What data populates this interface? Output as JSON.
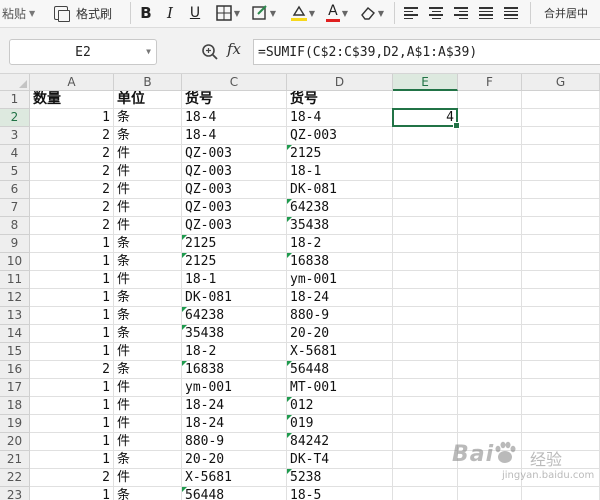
{
  "ribbon": {
    "paste_label": "粘贴",
    "format_painter_label": "格式刷",
    "bold_label": "B",
    "italic_label": "I",
    "underline_label": "U",
    "font_color_label": "A",
    "merge_center_label": "合并居中",
    "icons": [
      "format-painter-icon",
      "bold-icon",
      "italic-icon",
      "underline-icon",
      "border-icon",
      "fill-style-icon",
      "highlight-color-icon",
      "font-color-icon",
      "clear-format-icon",
      "align-left-icon",
      "align-center-icon",
      "align-right-icon",
      "justify-icon",
      "distribute-icon"
    ],
    "colors": {
      "highlight": "#f7d81c",
      "font_color": "#e02020"
    }
  },
  "formula_bar": {
    "name_box": "E2",
    "fx_label": "fx",
    "formula": "=SUMIF(C$2:C$39,D2,A$1:A$39)"
  },
  "grid": {
    "columns": [
      "A",
      "B",
      "C",
      "D",
      "E",
      "F",
      "G"
    ],
    "selected_column": "E",
    "selected_row": 2,
    "selected_cell": "E2",
    "selected_cell_value": "4",
    "accent_color": "#217346",
    "number_flag_color": "#1f9b4e",
    "header_row": {
      "A": "数量",
      "B": "单位",
      "C": "货号",
      "D": "货号"
    },
    "rows": [
      {
        "row": 2,
        "a": "1",
        "b": "条",
        "c": "18-4",
        "d": "18-4"
      },
      {
        "row": 3,
        "a": "2",
        "b": "条",
        "c": "18-4",
        "d": "QZ-003"
      },
      {
        "row": 4,
        "a": "2",
        "b": "件",
        "c": "QZ-003",
        "d": "2125"
      },
      {
        "row": 5,
        "a": "2",
        "b": "件",
        "c": "QZ-003",
        "d": "18-1"
      },
      {
        "row": 6,
        "a": "2",
        "b": "件",
        "c": "QZ-003",
        "d": "DK-081"
      },
      {
        "row": 7,
        "a": "2",
        "b": "件",
        "c": "QZ-003",
        "d": "64238"
      },
      {
        "row": 8,
        "a": "2",
        "b": "件",
        "c": "QZ-003",
        "d": "35438"
      },
      {
        "row": 9,
        "a": "1",
        "b": "条",
        "c": "2125",
        "d": "18-2"
      },
      {
        "row": 10,
        "a": "1",
        "b": "条",
        "c": "2125",
        "d": "16838"
      },
      {
        "row": 11,
        "a": "1",
        "b": "件",
        "c": "18-1",
        "d": "ym-001"
      },
      {
        "row": 12,
        "a": "1",
        "b": "条",
        "c": "DK-081",
        "d": "18-24"
      },
      {
        "row": 13,
        "a": "1",
        "b": "条",
        "c": "64238",
        "d": "880-9"
      },
      {
        "row": 14,
        "a": "1",
        "b": "条",
        "c": "35438",
        "d": "20-20"
      },
      {
        "row": 15,
        "a": "1",
        "b": "件",
        "c": "18-2",
        "d": "X-5681"
      },
      {
        "row": 16,
        "a": "2",
        "b": "条",
        "c": "16838",
        "d": "56448"
      },
      {
        "row": 17,
        "a": "1",
        "b": "件",
        "c": "ym-001",
        "d": "MT-001"
      },
      {
        "row": 18,
        "a": "1",
        "b": "件",
        "c": "18-24",
        "d": "012"
      },
      {
        "row": 19,
        "a": "1",
        "b": "件",
        "c": "18-24",
        "d": "019"
      },
      {
        "row": 20,
        "a": "1",
        "b": "件",
        "c": "880-9",
        "d": "84242"
      },
      {
        "row": 21,
        "a": "1",
        "b": "条",
        "c": "20-20",
        "d": "DK-T4"
      },
      {
        "row": 22,
        "a": "2",
        "b": "件",
        "c": "X-5681",
        "d": "5238"
      },
      {
        "row": 23,
        "a": "1",
        "b": "条",
        "c": "56448",
        "d": "18-5"
      }
    ],
    "flagged_cells": [
      "C9",
      "C10",
      "C13",
      "C14",
      "C16",
      "C23",
      "D4",
      "D7",
      "D8",
      "D10",
      "D16",
      "D18",
      "D19",
      "D20",
      "D22"
    ]
  },
  "watermark": {
    "logo_text": "Bai",
    "cn_text": "经验",
    "url_text": "jingyan.baidu.com"
  }
}
